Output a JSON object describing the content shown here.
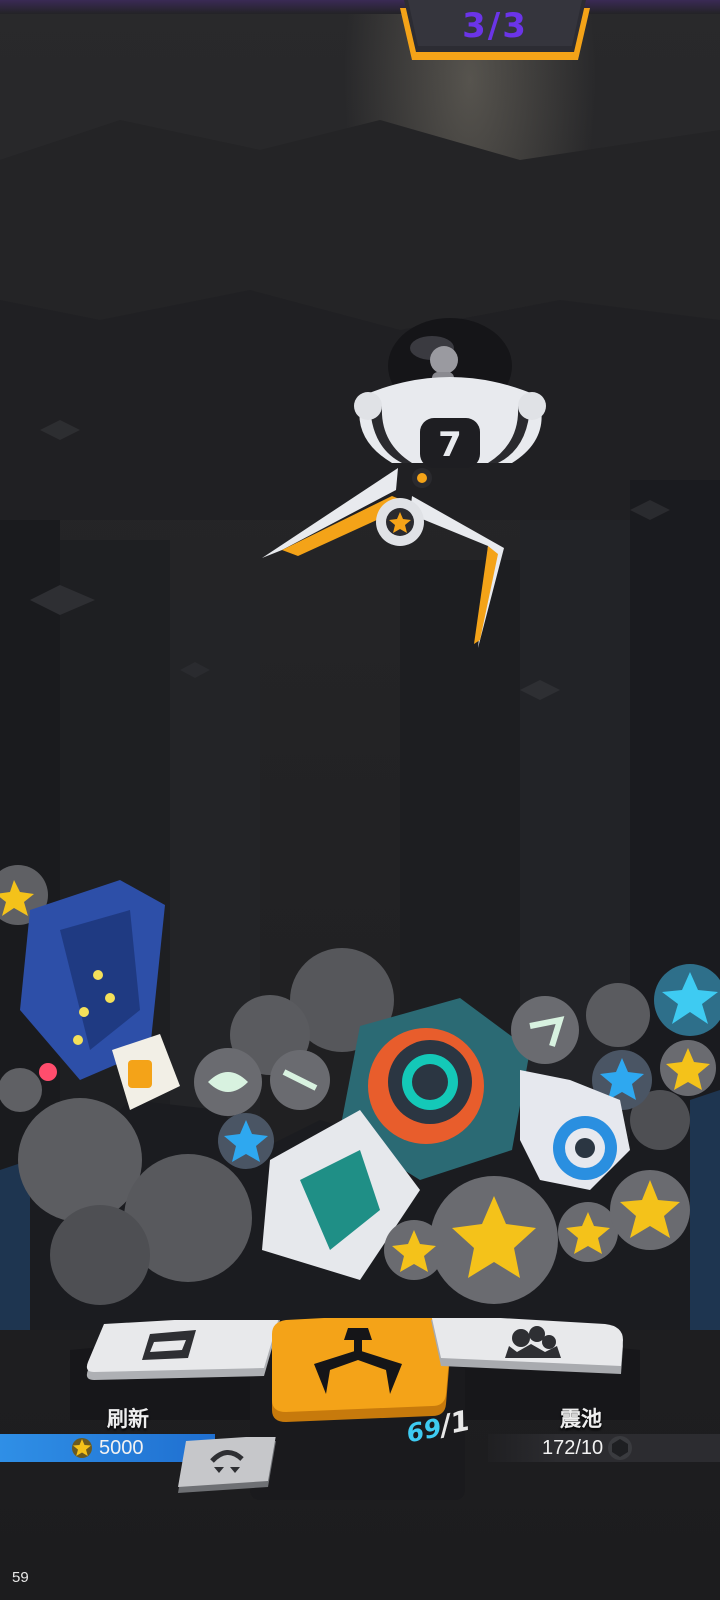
{
  "hud": {
    "round": "3/3",
    "fps": "59"
  },
  "controls": {
    "refresh": {
      "label": "刷新",
      "cost": "5000",
      "icon": "refresh-card-icon"
    },
    "grab": {
      "icon": "claw-icon",
      "count_current": "69",
      "count_sep": "/",
      "count_max": "1"
    },
    "shake": {
      "label": "震池",
      "progress": "172/10",
      "icon": "shake-pile-icon"
    },
    "swap": {
      "icon": "swap-claw-icon"
    }
  },
  "colors": {
    "accent_purple": "#6b34e8",
    "accent_orange": "#f4a318",
    "blue_bar": "#2f8fe6",
    "cyan_text": "#3ecbf2"
  }
}
